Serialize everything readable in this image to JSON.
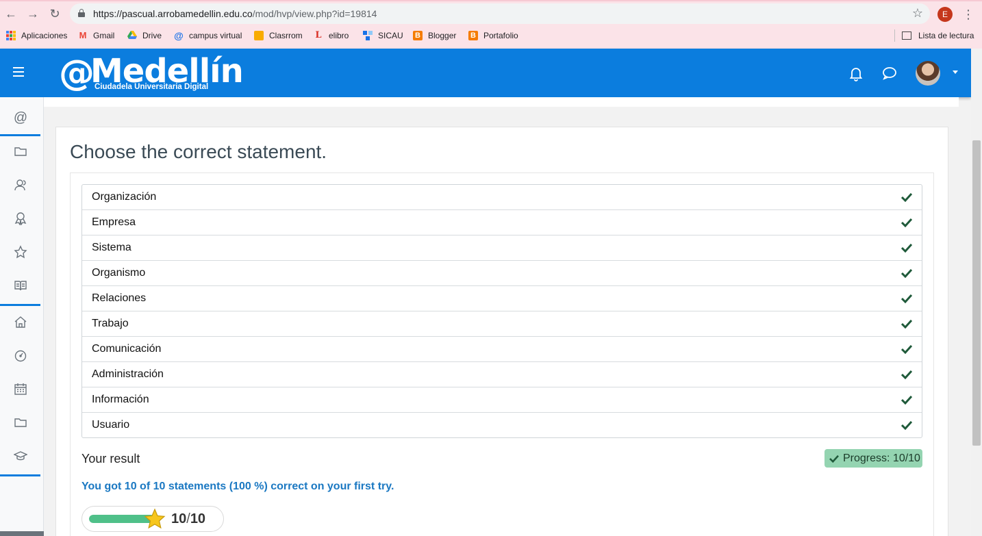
{
  "browser": {
    "url_host": "https://pascual.arrobamedellin.edu.co",
    "url_path": "/mod/hvp/view.php?id=19814",
    "profile_initial": "E",
    "bookmarks": [
      {
        "label": "Aplicaciones",
        "icon": "apps-grid-icon"
      },
      {
        "label": "Gmail",
        "icon": "gmail-icon",
        "color": "#ea4335"
      },
      {
        "label": "Drive",
        "icon": "drive-icon",
        "color": "#34a853"
      },
      {
        "label": "campus virtual",
        "icon": "at-sign-icon",
        "color": "#1a73e8"
      },
      {
        "label": "Clasrrom",
        "icon": "classroom-icon",
        "color": "#f9ab00"
      },
      {
        "label": "elibro",
        "icon": "elibro-icon",
        "color": "#d93025"
      },
      {
        "label": "SICAU",
        "icon": "sicau-icon",
        "color": "#1a73e8"
      },
      {
        "label": "Blogger",
        "icon": "blogger-icon",
        "color": "#f57c00"
      },
      {
        "label": "Portafolio",
        "icon": "blogger-icon",
        "color": "#f57c00"
      }
    ],
    "reading_list": "Lista de lectura"
  },
  "header": {
    "logo_at": "@",
    "logo_name": "Medellín",
    "logo_sub": "Ciudadela Universitaria Digital",
    "accent": "#0b7dde"
  },
  "sidebar": {
    "items": [
      "at-sign-icon",
      "folder-icon",
      "users-icon",
      "award-icon",
      "star-icon",
      "book-icon",
      "home-icon",
      "dashboard-icon",
      "calendar-icon",
      "folder-icon",
      "graduation-cap-icon"
    ]
  },
  "question": {
    "title": "Choose the correct statement.",
    "statements": [
      {
        "label": "Organización",
        "correct": true
      },
      {
        "label": "Empresa",
        "correct": true
      },
      {
        "label": "Sistema",
        "correct": true
      },
      {
        "label": "Organismo",
        "correct": true
      },
      {
        "label": "Relaciones",
        "correct": true
      },
      {
        "label": "Trabajo",
        "correct": true
      },
      {
        "label": "Comunicación",
        "correct": true
      },
      {
        "label": "Administración",
        "correct": true
      },
      {
        "label": "Información",
        "correct": true
      },
      {
        "label": "Usuario",
        "correct": true
      }
    ]
  },
  "result": {
    "label": "Your result",
    "progress_text": "Progress: 10/10",
    "feedback": "You got 10 of 10 statements (100 %) correct on your first try.",
    "score": "10",
    "max": "10",
    "fraction": 1.0,
    "badge_color": "#94d4b1",
    "check_color": "#1f5a3a"
  }
}
